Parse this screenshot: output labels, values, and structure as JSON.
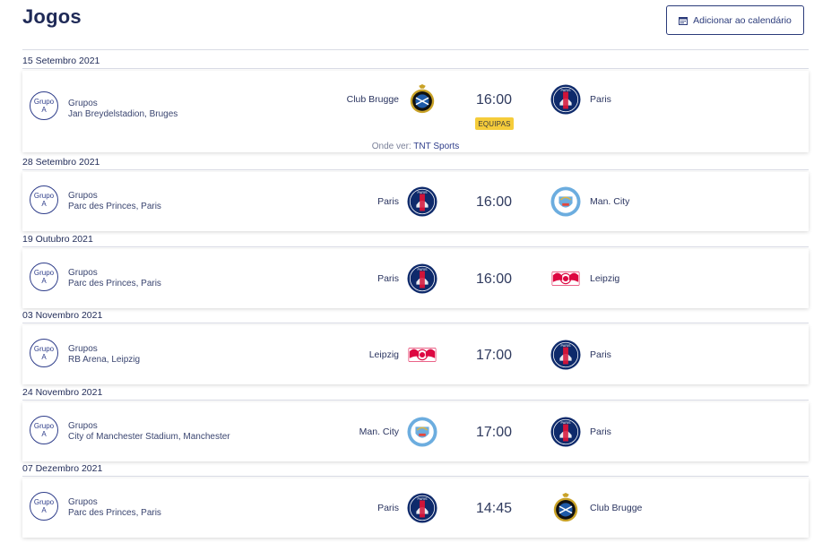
{
  "page": {
    "title": "Jogos"
  },
  "toolbar": {
    "add_calendar_label": "Adicionar ao calendário",
    "calendar_icon": "calendar-icon"
  },
  "colors": {
    "primary": "#1f2a57",
    "psg_blue": "#0e2a6b",
    "psg_red": "#d0143a",
    "city_blue": "#6caddf",
    "leipzig_red": "#dd0741",
    "badge_yellow": "#f5cc3a"
  },
  "matches": [
    {
      "date": "15 Setembro 2021",
      "group_line1": "Grupo",
      "group_line2": "A",
      "stage": "Grupos",
      "venue": "Jan Breydelstadion, Bruges",
      "home": "Club Brugge",
      "away": "Paris",
      "time": "16:00",
      "badge": "EQUIPAS",
      "where_label": "Onde ver:",
      "where_channel": "TNT Sports"
    },
    {
      "date": "28 Setembro 2021",
      "group_line1": "Grupo",
      "group_line2": "A",
      "stage": "Grupos",
      "venue": "Parc des Princes, Paris",
      "home": "Paris",
      "away": "Man. City",
      "time": "16:00"
    },
    {
      "date": "19 Outubro 2021",
      "group_line1": "Grupo",
      "group_line2": "A",
      "stage": "Grupos",
      "venue": "Parc des Princes, Paris",
      "home": "Paris",
      "away": "Leipzig",
      "time": "16:00"
    },
    {
      "date": "03 Novembro 2021",
      "group_line1": "Grupo",
      "group_line2": "A",
      "stage": "Grupos",
      "venue": "RB Arena, Leipzig",
      "home": "Leipzig",
      "away": "Paris",
      "time": "17:00"
    },
    {
      "date": "24 Novembro 2021",
      "group_line1": "Grupo",
      "group_line2": "A",
      "stage": "Grupos",
      "venue": "City of Manchester Stadium, Manchester",
      "home": "Man. City",
      "away": "Paris",
      "time": "17:00"
    },
    {
      "date": "07 Dezembro 2021",
      "group_line1": "Grupo",
      "group_line2": "A",
      "stage": "Grupos",
      "venue": "Parc des Princes, Paris",
      "home": "Paris",
      "away": "Club Brugge",
      "time": "14:45"
    }
  ]
}
